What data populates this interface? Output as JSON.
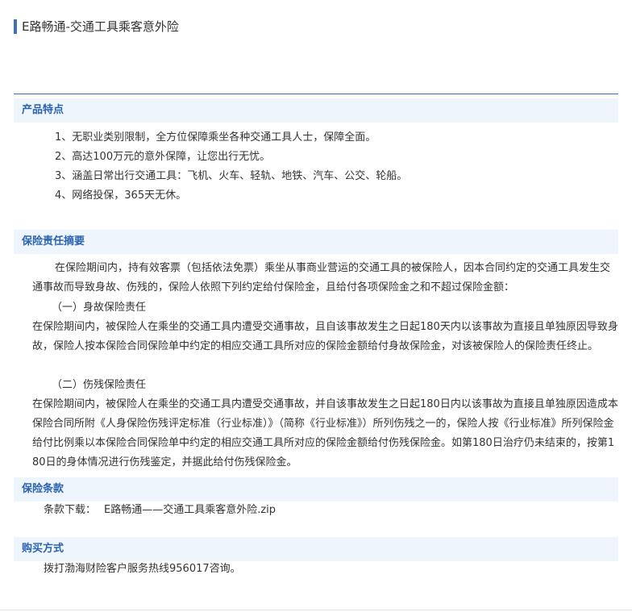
{
  "page": {
    "title": "E路畅通-交通工具乘客意外险"
  },
  "sections": {
    "features": {
      "heading": "产品特点",
      "items": [
        "1、无职业类别限制，全方位保障乘坐各种交通工具人士，保障全面。",
        "2、高达100万元的意外保障，让您出行无忧。",
        "3、涵盖日常出行交通工具：飞机、火车、轻轨、地铁、汽车、公交、轮船。",
        "4、网络投保，365天无休。"
      ]
    },
    "liability": {
      "heading": "保险责任摘要",
      "intro": "在保险期间内，持有效客票（包括依法免票）乘坐从事商业营运的交通工具的被保险人，因本合同约定的交通工具发生交通事故而导致身故、伤残的，保险人依照下列约定给付保险金，且给付各项保险金之和不超过保险金额：",
      "death_heading": "（一）身故保险责任",
      "death_text": "在保险期间内，被保险人在乘坐的交通工具内遭受交通事故，且自该事故发生之日起180天内以该事故为直接且单独原因导致身故，保险人按本保险合同保险单中约定的相应交通工具所对应的保险金额给付身故保险金，对该被保险人的保险责任终止。",
      "disability_heading": "（二）伤残保险责任",
      "disability_text": "在保险期间内，被保险人在乘坐的交通工具内遭受交通事故，并自该事故发生之日起180日内以该事故为直接且单独原因造成本保险合同所附《人身保险伤残评定标准（行业标准）》（简称《行业标准》）所列伤残之一的，保险人按《行业标准》所列保险金给付比例乘以本保险合同保险单中约定的相应交通工具所对应的保险金额给付伤残保险金。如第180日治疗仍未结束的，按第180日的身体情况进行伤残鉴定，并据此给付伤残保险金。"
    },
    "terms": {
      "heading": "保险条款",
      "download_label": "条款下载：",
      "download_link": "E路畅通——交通工具乘客意外险.zip"
    },
    "purchase": {
      "heading": "购买方式",
      "text": "拨打渤海财险客户服务热线956017咨询。"
    }
  },
  "colors": {
    "accent": "#3a72c0",
    "section_bg": "#eef5fc",
    "heading_text": "#2a64b1",
    "body_text": "#333333"
  }
}
